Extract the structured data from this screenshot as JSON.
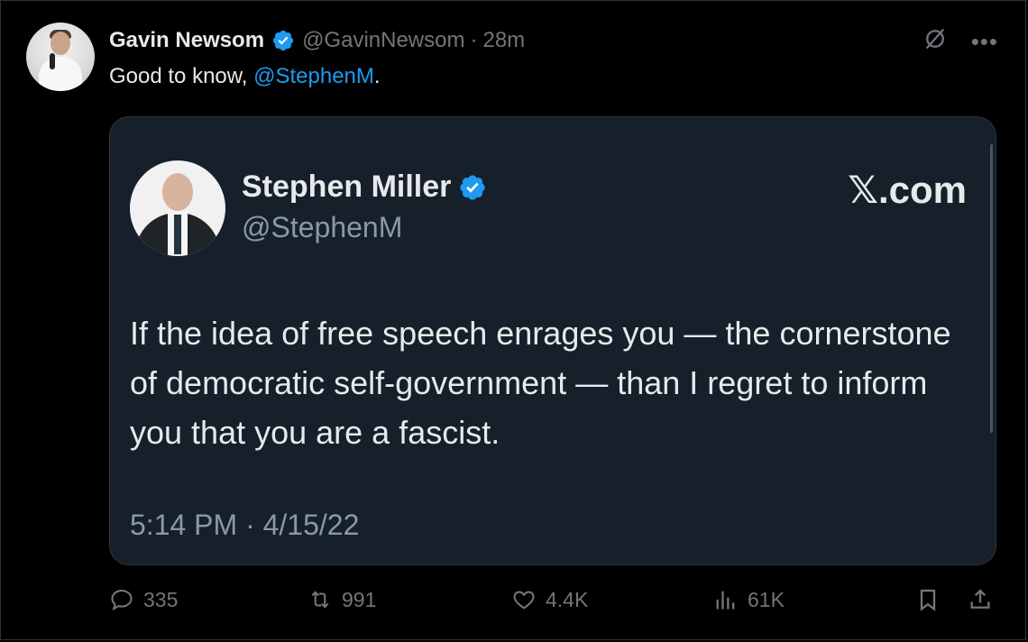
{
  "author": {
    "display_name": "Gavin Newsom",
    "handle": "@GavinNewsom",
    "separator": "·",
    "time_ago": "28m"
  },
  "tweet": {
    "text_prefix": "Good to know, ",
    "mention": "@StephenM",
    "text_suffix": "."
  },
  "quoted": {
    "display_name": "Stephen Miller",
    "handle": "@StephenM",
    "source": "𝕏.com",
    "body": "If the idea of free speech enrages you — the cornerstone of democratic self-government — than I regret to inform you that you are a fascist.",
    "timestamp": "5:14 PM · 4/15/22"
  },
  "actions": {
    "replies": "335",
    "reposts": "991",
    "likes": "4.4K",
    "views": "61K"
  },
  "colors": {
    "background": "#000000",
    "card_background": "#16202b",
    "accent": "#1d9bf0",
    "muted_text": "#71767b"
  },
  "icons": [
    "verified-badge-icon",
    "grok-icon",
    "more-icon",
    "reply-icon",
    "repost-icon",
    "like-icon",
    "views-icon",
    "bookmark-icon",
    "share-icon"
  ]
}
